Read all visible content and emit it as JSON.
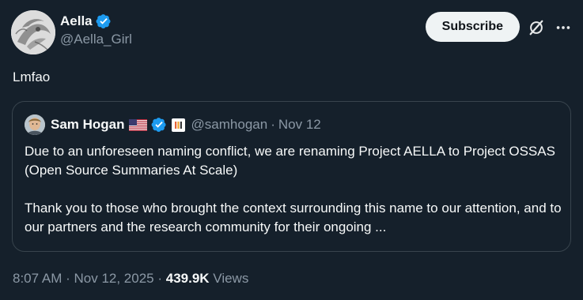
{
  "author": {
    "name": "Aella",
    "handle": "@Aella_Girl",
    "verified": true
  },
  "header": {
    "subscribe_label": "Subscribe"
  },
  "tweet": {
    "text": "Lmfao"
  },
  "quote": {
    "name": "Sam Hogan",
    "flag": "us-flag",
    "verified": true,
    "handle": "@samhogan",
    "separator": "·",
    "date": "Nov 12",
    "paragraphs": [
      "Due to an unforeseen naming conflict, we are renaming Project AELLA to Project OSSAS (Open Source Summaries At Scale)",
      "Thank you to those who brought the context surrounding this name to our attention, and to our partners and the research community for their ongoing ..."
    ]
  },
  "meta": {
    "time": "8:07 AM",
    "separator1": " · ",
    "date": "Nov 12, 2025",
    "separator2": " · ",
    "views_count": "439.9K",
    "views_label": " Views"
  },
  "colors": {
    "background": "#15202b",
    "border": "#38444d",
    "secondary_text": "#8b98a5",
    "primary_text": "#f7f9f9",
    "verified_blue": "#1d9bf0",
    "button_bg": "#eff3f4"
  },
  "icons": {
    "verified": "verified-badge-icon",
    "grok": "grok-icon",
    "more": "more-dots-icon",
    "affiliate": "affiliate-badge-icon"
  }
}
